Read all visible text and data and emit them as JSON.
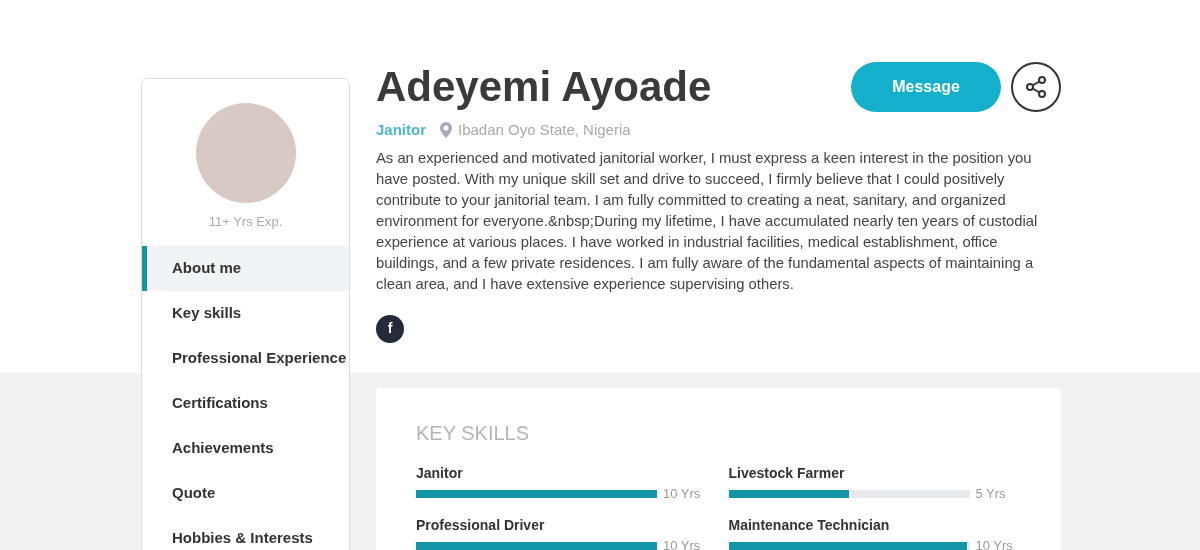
{
  "profile": {
    "experience": "11+ Yrs Exp.",
    "name": "Adeyemi Ayoade",
    "role": "Janitor",
    "location": "Ibadan Oyo State, Nigeria",
    "bio": "As an experienced and motivated janitorial worker, I must express a keen interest in the position you have posted. With my unique skill set and drive to succeed, I firmly believe that I could positively contribute to your janitorial team. I am fully committed to creating a neat, sanitary, and organized environment for everyone.&nbsp;During my lifetime, I have accumulated nearly ten years of custodial experience at various places. I have worked in industrial facilities, medical establishment, office buildings, and a few private residences. I am fully aware of the fundamental aspects of maintaining a clean area, and I have extensive experience supervising others.",
    "message_button": "Message",
    "social_links": [
      {
        "kind": "facebook",
        "label": "f"
      }
    ]
  },
  "sidebar": {
    "items": [
      {
        "label": "About me",
        "selected": true
      },
      {
        "label": "Key skills",
        "selected": false
      },
      {
        "label": "Professional Experience",
        "selected": false
      },
      {
        "label": "Certifications",
        "selected": false
      },
      {
        "label": "Achievements",
        "selected": false
      },
      {
        "label": "Quote",
        "selected": false
      },
      {
        "label": "Hobbies & Interests",
        "selected": false
      }
    ]
  },
  "key_skills": {
    "title": "KEY SKILLS",
    "skills": [
      {
        "name": "Janitor",
        "level": 1,
        "reading": "10 Yrs"
      },
      {
        "name": "Livestock Farmer",
        "level": 0.5,
        "reading": "5 Yrs"
      },
      {
        "name": "Professional Driver",
        "level": 1,
        "reading": "10 Yrs"
      },
      {
        "name": "Maintenance Technician",
        "level": 0.99,
        "reading": "10 Yrs"
      }
    ]
  }
}
